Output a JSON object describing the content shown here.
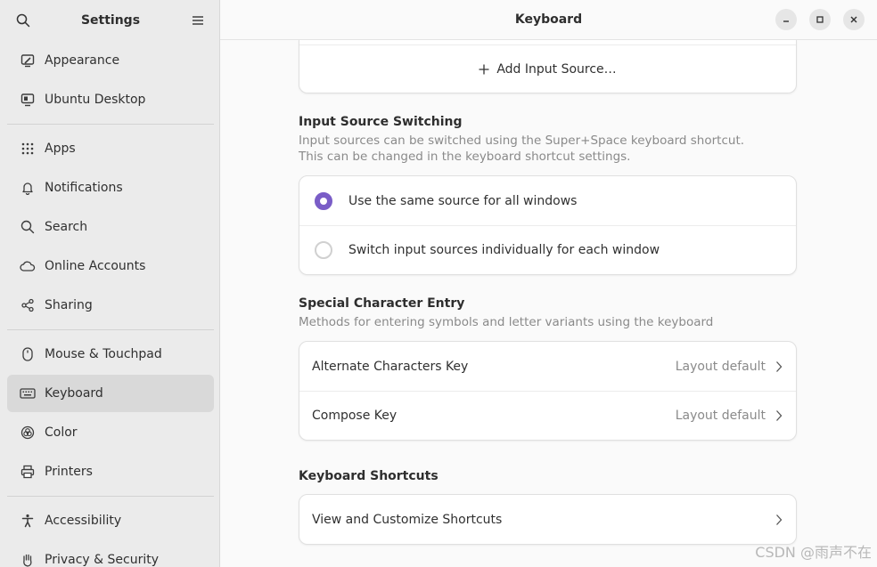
{
  "sidebar": {
    "title": "Settings",
    "groups": [
      [
        {
          "label": "Appearance",
          "icon": "appearance-icon"
        },
        {
          "label": "Ubuntu Desktop",
          "icon": "desktop-icon"
        }
      ],
      [
        {
          "label": "Apps",
          "icon": "apps-grid-icon"
        },
        {
          "label": "Notifications",
          "icon": "bell-icon"
        },
        {
          "label": "Search",
          "icon": "search-icon"
        },
        {
          "label": "Online Accounts",
          "icon": "cloud-icon"
        },
        {
          "label": "Sharing",
          "icon": "share-icon"
        }
      ],
      [
        {
          "label": "Mouse & Touchpad",
          "icon": "mouse-icon"
        },
        {
          "label": "Keyboard",
          "icon": "keyboard-icon",
          "selected": true
        },
        {
          "label": "Color",
          "icon": "color-icon"
        },
        {
          "label": "Printers",
          "icon": "printer-icon"
        }
      ],
      [
        {
          "label": "Accessibility",
          "icon": "accessibility-icon"
        },
        {
          "label": "Privacy & Security",
          "icon": "hand-icon"
        }
      ]
    ]
  },
  "header": {
    "title": "Keyboard"
  },
  "input_sources": {
    "add_label": "Add Input Source…"
  },
  "switching": {
    "title": "Input Source Switching",
    "desc_line1": "Input sources can be switched using the Super+Space keyboard shortcut.",
    "desc_line2": "This can be changed in the keyboard shortcut settings.",
    "options": [
      {
        "label": "Use the same source for all windows",
        "selected": true
      },
      {
        "label": "Switch input sources individually for each window",
        "selected": false
      }
    ]
  },
  "special": {
    "title": "Special Character Entry",
    "desc": "Methods for entering symbols and letter variants using the keyboard",
    "rows": [
      {
        "label": "Alternate Characters Key",
        "value": "Layout default"
      },
      {
        "label": "Compose Key",
        "value": "Layout default"
      }
    ]
  },
  "shortcuts": {
    "title": "Keyboard Shortcuts",
    "row_label": "View and Customize Shortcuts"
  },
  "watermark": "CSDN @雨声不在",
  "colors": {
    "accent": "#7a5dc7",
    "sidebar_bg": "#ebebeb",
    "selected_bg": "#d9d9d9"
  }
}
